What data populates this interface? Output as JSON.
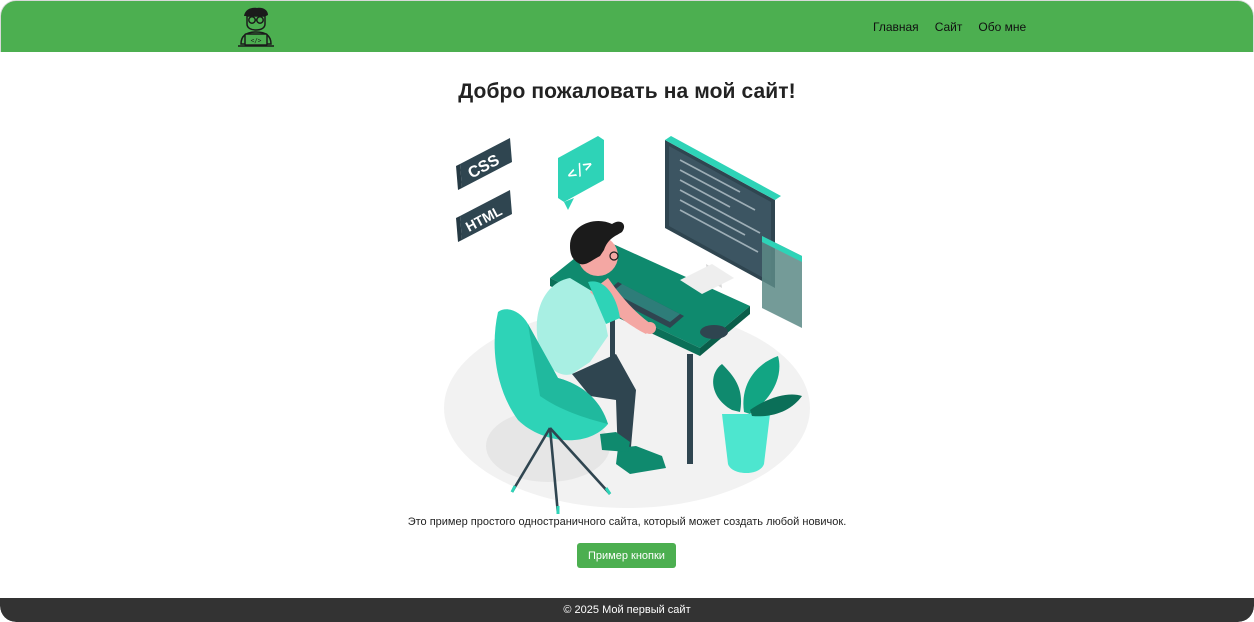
{
  "header": {
    "logo_icon": "coder-glasses-icon",
    "nav": [
      {
        "label": "Главная"
      },
      {
        "label": "Сайт"
      },
      {
        "label": "Обо мне"
      }
    ],
    "brand_color": "#4caf50"
  },
  "main": {
    "title": "Добро пожаловать на мой сайт!",
    "hero": {
      "badge_css": "CSS",
      "badge_html": "HTML",
      "code_icon": "code-bubble-icon"
    },
    "description": "Это пример простого одностраничного сайта, который может создать любой новичок.",
    "button_label": "Пример кнопки",
    "accent_color": "#2ed3b7"
  },
  "footer": {
    "text": "© 2025 Мой первый сайт",
    "color": "#333333"
  }
}
